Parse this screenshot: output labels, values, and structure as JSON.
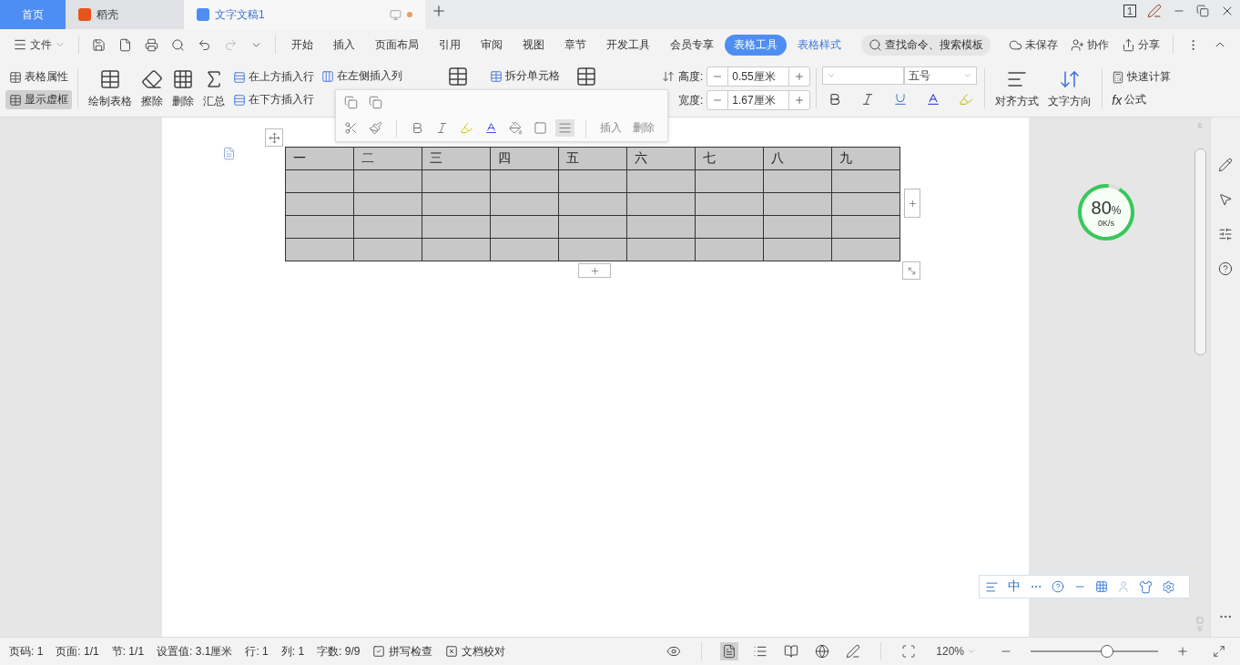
{
  "tabs": [
    {
      "label": "首页",
      "kind": "home",
      "selected": false
    },
    {
      "label": "稻壳",
      "kind": "app",
      "selected": false
    },
    {
      "label": "文字文稿1",
      "kind": "doc",
      "selected": true,
      "modified": true
    }
  ],
  "window": {
    "badge": "1"
  },
  "menu": {
    "file": "文件",
    "tabs": [
      {
        "label": "开始",
        "selected": false
      },
      {
        "label": "插入",
        "selected": false
      },
      {
        "label": "页面布局",
        "selected": false
      },
      {
        "label": "引用",
        "selected": false
      },
      {
        "label": "审阅",
        "selected": false
      },
      {
        "label": "视图",
        "selected": false
      },
      {
        "label": "章节",
        "selected": false
      },
      {
        "label": "开发工具",
        "selected": false
      },
      {
        "label": "会员专享",
        "selected": false
      },
      {
        "label": "表格工具",
        "selected": true
      },
      {
        "label": "表格样式",
        "selected": false
      }
    ],
    "search": {
      "placeholder": "查找命令、搜索模板"
    },
    "actions": [
      "未保存",
      "协作",
      "分享"
    ]
  },
  "ribbon": {
    "left": [
      {
        "label": "表格属性",
        "selected": false
      },
      {
        "label": "显示虚框",
        "selected": true
      }
    ],
    "big": [
      "绘制表格",
      "擦除",
      "删除",
      "汇总"
    ],
    "rows": [
      "在上方插入行",
      "在下方插入行"
    ],
    "cols": [
      "在左侧插入列"
    ],
    "split": "拆分单元格",
    "height": {
      "label": "高度:",
      "value": "0.55厘米"
    },
    "width": {
      "label": "宽度:",
      "value": "1.67厘米"
    },
    "font": {
      "size": "五号"
    },
    "align": [
      "对齐方式",
      "文字方向"
    ],
    "calc": "快速计算",
    "formula_icon": "fx",
    "formula": "公式"
  },
  "mini_toolbar": {
    "buttons": [
      "插入",
      "删除"
    ]
  },
  "table": {
    "selected": true,
    "header": [
      "一",
      "二",
      "三",
      "四",
      "五",
      "六",
      "七",
      "八",
      "九"
    ]
  },
  "meter": {
    "value": "80",
    "unit": "%",
    "speed": "0K/s"
  },
  "ime": {
    "label": "中"
  },
  "status_bar": {
    "items": [
      "页码: 1",
      "页面: 1/1",
      "节: 1/1",
      "设置值: 3.1厘米",
      "行: 1",
      "列: 1",
      "字数: 9/9"
    ],
    "spell": {
      "label": "拼写检查",
      "checked": true
    },
    "proof": {
      "label": "文档校对"
    },
    "zoom": "120%",
    "zoom_level": {
      "level": 0.6
    }
  }
}
